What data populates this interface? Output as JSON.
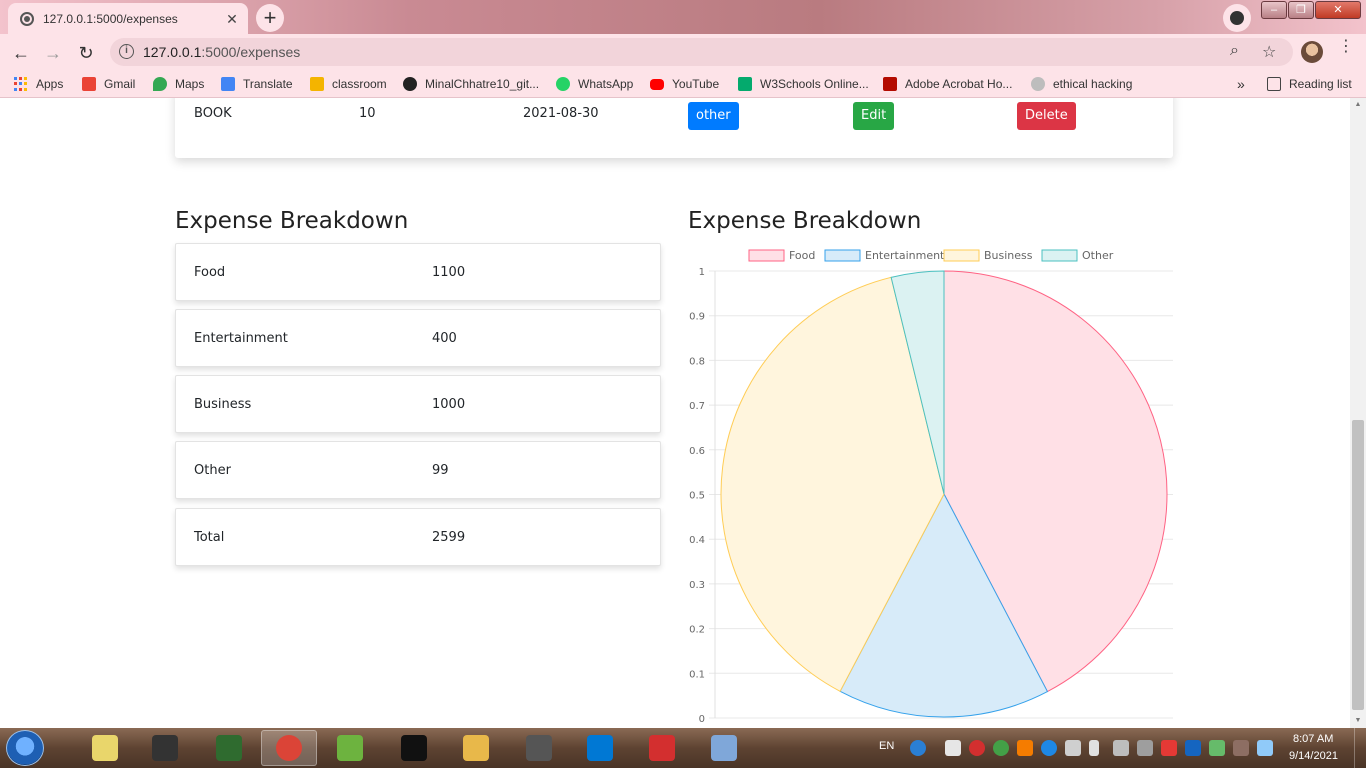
{
  "browser": {
    "tab_title": "127.0.0.1:5000/expenses",
    "url_host": "127.0.0.1",
    "url_path": ":5000/expenses",
    "bookmarks": [
      {
        "label": "Apps",
        "icon": "apps-grid-icon"
      },
      {
        "label": "Gmail",
        "icon": "gmail-icon",
        "color": "#ea4335"
      },
      {
        "label": "Maps",
        "icon": "maps-icon",
        "color": "#34a853"
      },
      {
        "label": "Translate",
        "icon": "translate-icon",
        "color": "#4285f4"
      },
      {
        "label": "classroom",
        "icon": "classroom-icon",
        "color": "#f4b400"
      },
      {
        "label": "MinalChhatre10_git...",
        "icon": "github-icon",
        "color": "#222222"
      },
      {
        "label": "WhatsApp",
        "icon": "whatsapp-icon",
        "color": "#25d366"
      },
      {
        "label": "YouTube",
        "icon": "youtube-icon",
        "color": "#ff0000"
      },
      {
        "label": "W3Schools Online...",
        "icon": "w3schools-icon",
        "color": "#04aa6d"
      },
      {
        "label": "Adobe Acrobat Ho...",
        "icon": "acrobat-icon",
        "color": "#b30b00"
      },
      {
        "label": "ethical hacking",
        "icon": "globe-icon",
        "color": "#9e9e9e"
      }
    ],
    "more_bookmarks": "»",
    "reading_list": "Reading list"
  },
  "expense_row": {
    "name": "BOOK",
    "amount": "10",
    "date": "2021-08-30",
    "category_label": "other",
    "edit_label": "Edit",
    "delete_label": "Delete"
  },
  "breakdown": {
    "title": "Expense Breakdown",
    "rows": [
      {
        "category": "Food",
        "amount": "1100"
      },
      {
        "category": "Entertainment",
        "amount": "400"
      },
      {
        "category": "Business",
        "amount": "1000"
      },
      {
        "category": "Other",
        "amount": "99"
      }
    ],
    "total_label": "Total",
    "total_amount": "2599"
  },
  "chart_title": "Expense Breakdown",
  "chart_data": {
    "type": "pie",
    "categories": [
      "Food",
      "Entertainment",
      "Business",
      "Other"
    ],
    "values": [
      1100,
      400,
      1000,
      99
    ],
    "fill_colors": [
      "#ffe0e6",
      "#d7ebf9",
      "#fff5dd",
      "#dbf2f2"
    ],
    "stroke_colors": [
      "#ff6384",
      "#36a2eb",
      "#ffcd56",
      "#4bc0c0"
    ],
    "legend_position": "top",
    "y_axis_ticks": [
      "0",
      "0.1",
      "0.2",
      "0.3",
      "0.4",
      "0.5",
      "0.6",
      "0.7",
      "0.8",
      "0.9",
      "1"
    ],
    "grid": true
  },
  "taskbar": {
    "language": "EN",
    "time": "8:07 AM",
    "date": "9/14/2021",
    "apps": [
      {
        "name": "sticky-notes",
        "color": "#e9d66b"
      },
      {
        "name": "ms-tc",
        "color": "#333333"
      },
      {
        "name": "system-monitor",
        "color": "#2f6b2f"
      },
      {
        "name": "chrome",
        "color": "#db4437",
        "active": true
      },
      {
        "name": "notepad-plus-plus",
        "color": "#6db33f"
      },
      {
        "name": "command-prompt",
        "color": "#111111"
      },
      {
        "name": "file-explorer",
        "color": "#e8b84a"
      },
      {
        "name": "media-player-classic",
        "color": "#555555"
      },
      {
        "name": "vs-code",
        "color": "#0078d4"
      },
      {
        "name": "editor-app",
        "color": "#d32f2f"
      },
      {
        "name": "paint",
        "color": "#7fa7d9"
      }
    ]
  }
}
